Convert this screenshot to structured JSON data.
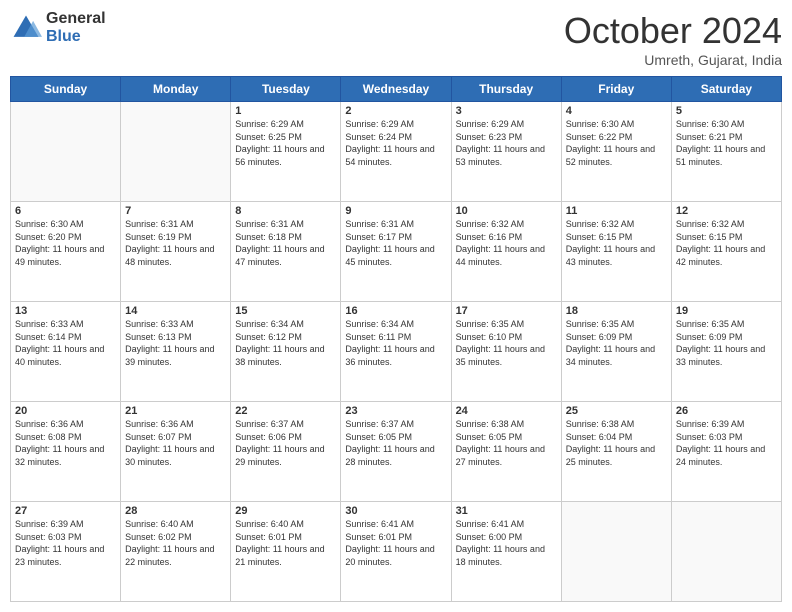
{
  "logo": {
    "general": "General",
    "blue": "Blue"
  },
  "header": {
    "month": "October 2024",
    "location": "Umreth, Gujarat, India"
  },
  "weekdays": [
    "Sunday",
    "Monday",
    "Tuesday",
    "Wednesday",
    "Thursday",
    "Friday",
    "Saturday"
  ],
  "weeks": [
    [
      {
        "day": "",
        "sunrise": "",
        "sunset": "",
        "daylight": ""
      },
      {
        "day": "",
        "sunrise": "",
        "sunset": "",
        "daylight": ""
      },
      {
        "day": "1",
        "sunrise": "Sunrise: 6:29 AM",
        "sunset": "Sunset: 6:25 PM",
        "daylight": "Daylight: 11 hours and 56 minutes."
      },
      {
        "day": "2",
        "sunrise": "Sunrise: 6:29 AM",
        "sunset": "Sunset: 6:24 PM",
        "daylight": "Daylight: 11 hours and 54 minutes."
      },
      {
        "day": "3",
        "sunrise": "Sunrise: 6:29 AM",
        "sunset": "Sunset: 6:23 PM",
        "daylight": "Daylight: 11 hours and 53 minutes."
      },
      {
        "day": "4",
        "sunrise": "Sunrise: 6:30 AM",
        "sunset": "Sunset: 6:22 PM",
        "daylight": "Daylight: 11 hours and 52 minutes."
      },
      {
        "day": "5",
        "sunrise": "Sunrise: 6:30 AM",
        "sunset": "Sunset: 6:21 PM",
        "daylight": "Daylight: 11 hours and 51 minutes."
      }
    ],
    [
      {
        "day": "6",
        "sunrise": "Sunrise: 6:30 AM",
        "sunset": "Sunset: 6:20 PM",
        "daylight": "Daylight: 11 hours and 49 minutes."
      },
      {
        "day": "7",
        "sunrise": "Sunrise: 6:31 AM",
        "sunset": "Sunset: 6:19 PM",
        "daylight": "Daylight: 11 hours and 48 minutes."
      },
      {
        "day": "8",
        "sunrise": "Sunrise: 6:31 AM",
        "sunset": "Sunset: 6:18 PM",
        "daylight": "Daylight: 11 hours and 47 minutes."
      },
      {
        "day": "9",
        "sunrise": "Sunrise: 6:31 AM",
        "sunset": "Sunset: 6:17 PM",
        "daylight": "Daylight: 11 hours and 45 minutes."
      },
      {
        "day": "10",
        "sunrise": "Sunrise: 6:32 AM",
        "sunset": "Sunset: 6:16 PM",
        "daylight": "Daylight: 11 hours and 44 minutes."
      },
      {
        "day": "11",
        "sunrise": "Sunrise: 6:32 AM",
        "sunset": "Sunset: 6:15 PM",
        "daylight": "Daylight: 11 hours and 43 minutes."
      },
      {
        "day": "12",
        "sunrise": "Sunrise: 6:32 AM",
        "sunset": "Sunset: 6:15 PM",
        "daylight": "Daylight: 11 hours and 42 minutes."
      }
    ],
    [
      {
        "day": "13",
        "sunrise": "Sunrise: 6:33 AM",
        "sunset": "Sunset: 6:14 PM",
        "daylight": "Daylight: 11 hours and 40 minutes."
      },
      {
        "day": "14",
        "sunrise": "Sunrise: 6:33 AM",
        "sunset": "Sunset: 6:13 PM",
        "daylight": "Daylight: 11 hours and 39 minutes."
      },
      {
        "day": "15",
        "sunrise": "Sunrise: 6:34 AM",
        "sunset": "Sunset: 6:12 PM",
        "daylight": "Daylight: 11 hours and 38 minutes."
      },
      {
        "day": "16",
        "sunrise": "Sunrise: 6:34 AM",
        "sunset": "Sunset: 6:11 PM",
        "daylight": "Daylight: 11 hours and 36 minutes."
      },
      {
        "day": "17",
        "sunrise": "Sunrise: 6:35 AM",
        "sunset": "Sunset: 6:10 PM",
        "daylight": "Daylight: 11 hours and 35 minutes."
      },
      {
        "day": "18",
        "sunrise": "Sunrise: 6:35 AM",
        "sunset": "Sunset: 6:09 PM",
        "daylight": "Daylight: 11 hours and 34 minutes."
      },
      {
        "day": "19",
        "sunrise": "Sunrise: 6:35 AM",
        "sunset": "Sunset: 6:09 PM",
        "daylight": "Daylight: 11 hours and 33 minutes."
      }
    ],
    [
      {
        "day": "20",
        "sunrise": "Sunrise: 6:36 AM",
        "sunset": "Sunset: 6:08 PM",
        "daylight": "Daylight: 11 hours and 32 minutes."
      },
      {
        "day": "21",
        "sunrise": "Sunrise: 6:36 AM",
        "sunset": "Sunset: 6:07 PM",
        "daylight": "Daylight: 11 hours and 30 minutes."
      },
      {
        "day": "22",
        "sunrise": "Sunrise: 6:37 AM",
        "sunset": "Sunset: 6:06 PM",
        "daylight": "Daylight: 11 hours and 29 minutes."
      },
      {
        "day": "23",
        "sunrise": "Sunrise: 6:37 AM",
        "sunset": "Sunset: 6:05 PM",
        "daylight": "Daylight: 11 hours and 28 minutes."
      },
      {
        "day": "24",
        "sunrise": "Sunrise: 6:38 AM",
        "sunset": "Sunset: 6:05 PM",
        "daylight": "Daylight: 11 hours and 27 minutes."
      },
      {
        "day": "25",
        "sunrise": "Sunrise: 6:38 AM",
        "sunset": "Sunset: 6:04 PM",
        "daylight": "Daylight: 11 hours and 25 minutes."
      },
      {
        "day": "26",
        "sunrise": "Sunrise: 6:39 AM",
        "sunset": "Sunset: 6:03 PM",
        "daylight": "Daylight: 11 hours and 24 minutes."
      }
    ],
    [
      {
        "day": "27",
        "sunrise": "Sunrise: 6:39 AM",
        "sunset": "Sunset: 6:03 PM",
        "daylight": "Daylight: 11 hours and 23 minutes."
      },
      {
        "day": "28",
        "sunrise": "Sunrise: 6:40 AM",
        "sunset": "Sunset: 6:02 PM",
        "daylight": "Daylight: 11 hours and 22 minutes."
      },
      {
        "day": "29",
        "sunrise": "Sunrise: 6:40 AM",
        "sunset": "Sunset: 6:01 PM",
        "daylight": "Daylight: 11 hours and 21 minutes."
      },
      {
        "day": "30",
        "sunrise": "Sunrise: 6:41 AM",
        "sunset": "Sunset: 6:01 PM",
        "daylight": "Daylight: 11 hours and 20 minutes."
      },
      {
        "day": "31",
        "sunrise": "Sunrise: 6:41 AM",
        "sunset": "Sunset: 6:00 PM",
        "daylight": "Daylight: 11 hours and 18 minutes."
      },
      {
        "day": "",
        "sunrise": "",
        "sunset": "",
        "daylight": ""
      },
      {
        "day": "",
        "sunrise": "",
        "sunset": "",
        "daylight": ""
      }
    ]
  ]
}
